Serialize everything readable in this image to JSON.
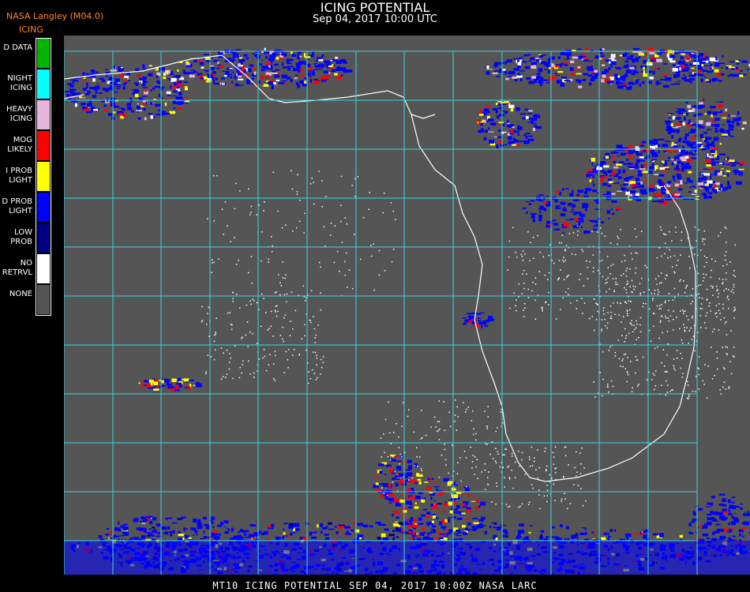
{
  "header": {
    "title": "ICING POTENTIAL",
    "subtitle": "Sep 04, 2017 10:00 UTC",
    "producer": "NASA Langley (M04.0)",
    "product": "ICING"
  },
  "legend": {
    "items": [
      {
        "label": "D DATA",
        "color": "#00b400"
      },
      {
        "label": "NIGHT\nICING",
        "color": "#00ffff"
      },
      {
        "label": "HEAVY\nICING",
        "color": "#e6b4dc"
      },
      {
        "label": "MOG\nLIKELY",
        "color": "#ff0000"
      },
      {
        "label": "I PROB\nLIGHT",
        "color": "#ffff00"
      },
      {
        "label": "D PROB\nLIGHT",
        "color": "#0000ff"
      },
      {
        "label": "LOW\nPROB",
        "color": "#000080"
      },
      {
        "label": "NO\nRETRVL",
        "color": "#ffffff"
      },
      {
        "label": "NONE",
        "color": "#555555"
      }
    ]
  },
  "map": {
    "background_color": "#555555",
    "grid_color": "#38d8e0",
    "coastline_color": "#ffffff",
    "grid_label_color": "#cc1010"
  },
  "footer": {
    "text": "MT10  ICING POTENTIAL   SEP 04, 2017 10:00Z   NASA LARC"
  }
}
